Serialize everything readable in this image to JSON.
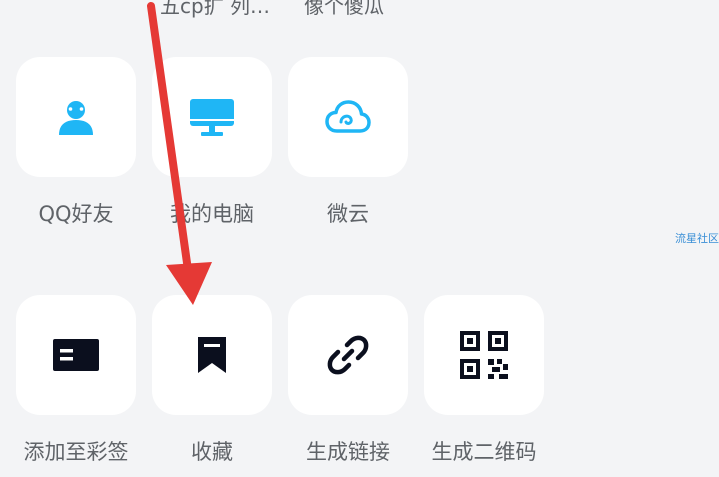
{
  "top_row_labels": [
    "五cp扩 列…",
    "像个傻瓜"
  ],
  "share_targets": [
    {
      "label": "QQ好友",
      "icon": "qq-friend-icon"
    },
    {
      "label": "我的电脑",
      "icon": "computer-monitor-icon"
    },
    {
      "label": "微云",
      "icon": "weiyun-cloud-icon"
    }
  ],
  "actions": [
    {
      "label": "添加至彩签",
      "icon": "tag-card-icon"
    },
    {
      "label": "收藏",
      "icon": "bookmark-icon"
    },
    {
      "label": "生成链接",
      "icon": "link-icon"
    },
    {
      "label": "生成二维码",
      "icon": "qr-code-icon"
    }
  ],
  "watermark": "流星社区",
  "colors": {
    "background": "#f3f4f6",
    "tile": "#ffffff",
    "accent_blue": "#1fb6f5",
    "dark_icon": "#0b0f1e",
    "annotation_arrow": "#e53935"
  }
}
